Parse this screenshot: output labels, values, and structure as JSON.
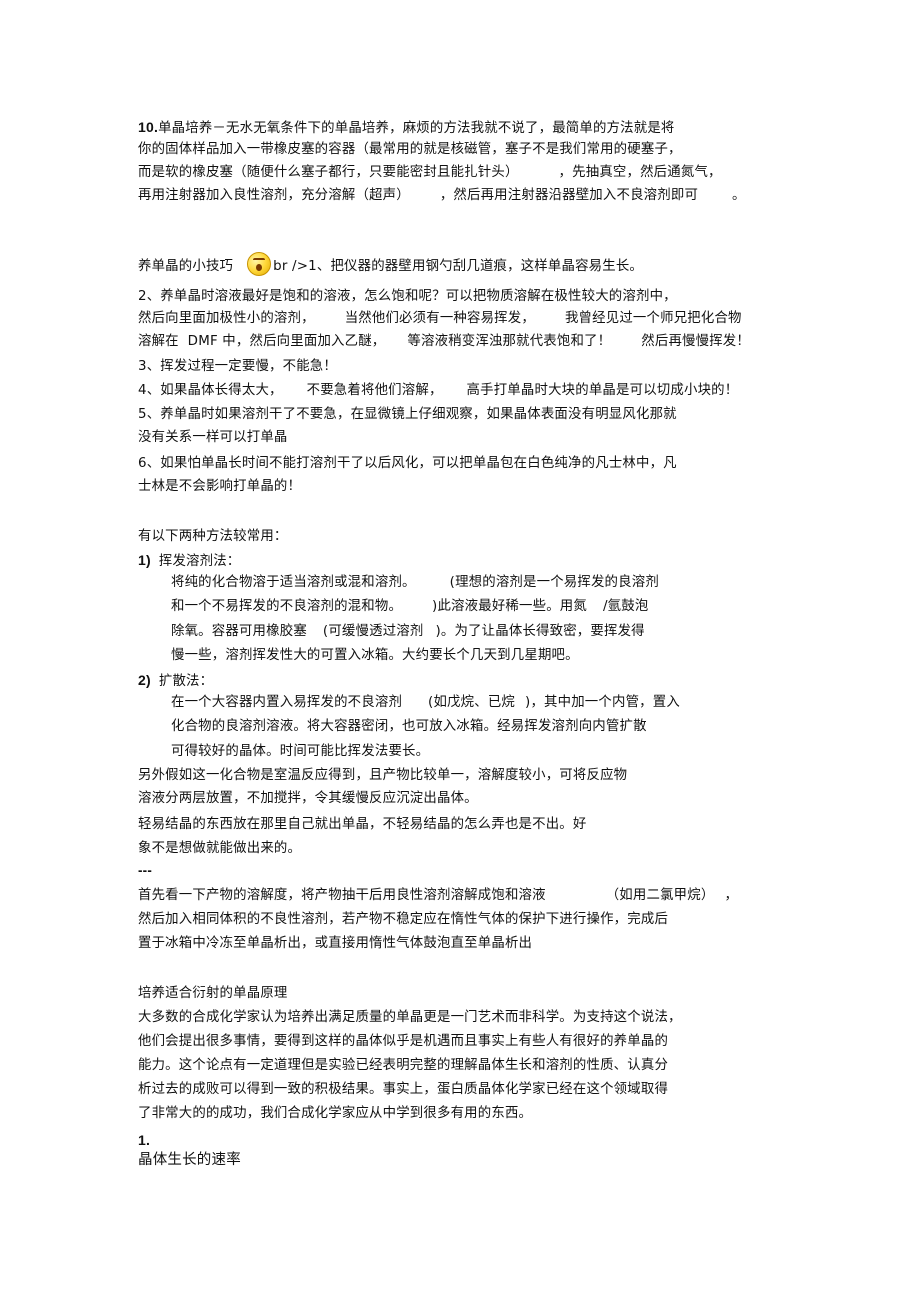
{
  "section1": {
    "num": "10.",
    "lines": [
      "单晶培养－无水无氧条件下的单晶培养，麻烦的方法我就不说了，最简单的方法就是将",
      "你的固体样品加入一带橡皮塞的容器（最常用的就是核磁管，塞子不是我们常用的硬塞子，",
      "而是软的橡皮塞（随便什么塞子都行，只要能密封且能扎针头）",
      "，先抽真空，然后通氮气，",
      "再用注射器加入良性溶剂，充分溶解（超声）",
      "，然后再用注射器沿器壁加入不良溶剂即可",
      "。"
    ]
  },
  "tips": {
    "title": "养单晶的小技巧",
    "emoji": "shocked-face-emoticon",
    "after_emoji": "br />1、把仪器的器壁用钢勺刮几道痕，这样单晶容易生长。",
    "item2": [
      "2、养单晶时溶液最好是饱和的溶液，怎么饱和呢？可以把物质溶解在极性较大的溶剂中，",
      "然后向里面加极性小的溶剂，",
      "当然他们必须有一种容易挥发，",
      "我曾经见过一个师兄把化合物",
      "溶解在  DMF 中，然后向里面加入乙醚，",
      "等溶液稍变浑浊那就代表饱和了！",
      "然后再慢慢挥发！"
    ],
    "item3": "3、挥发过程一定要慢，不能急！",
    "item4": [
      "4、如果晶体长得太大，",
      "不要急着将他们溶解，",
      "高手打单晶时大块的单晶是可以切成小块的！"
    ],
    "item5": [
      "5、养单晶时如果溶剂干了不要急，在显微镜上仔细观察，如果晶体表面没有明显风化那就",
      "没有关系一样可以打单晶"
    ],
    "item6": [
      "6、如果怕单晶长时间不能打溶剂干了以后风化，可以把单晶包在白色纯净的凡士林中，凡",
      "士林是不会影响打单晶的！"
    ]
  },
  "methods": {
    "intro": "有以下两种方法较常用：",
    "m1_num": "1)",
    "m1_title": "挥发溶剂法：",
    "m1_lines": [
      [
        "将纯的化合物溶于适当溶剂或混和溶剂。",
        "(理想的溶剂是一个易挥发的良溶剂"
      ],
      [
        "和一个不易挥发的不良溶剂的混和物。",
        ")此溶液最好稀一些。用氮",
        "/氩鼓泡"
      ],
      [
        "除氧。容器可用橡胶塞",
        "(可缓慢透过溶剂",
        ")。为了让晶体长得致密，要挥发得"
      ],
      [
        "慢一些，溶剂挥发性大的可置入冰箱。大约要长个几天到几星期吧。"
      ]
    ],
    "m2_num": "2)",
    "m2_title": "扩散法：",
    "m2_lines": [
      [
        "在一个大容器内置入易挥发的不良溶剂",
        "(如戊烷、已烷",
        ")，其中加一个内管，置入"
      ],
      [
        "化合物的良溶剂溶液。将大容器密闭，也可放入冰箱。经易挥发溶剂向内管扩散"
      ],
      [
        "可得较好的晶体。时间可能比挥发法要长。"
      ]
    ],
    "extra": [
      "另外假如这一化合物是室温反应得到，且产物比较单一，溶解度较小，可将反应物",
      "溶液分两层放置，不加搅拌，令其缓慢反应沉淀出晶体。",
      "轻易结晶的东西放在那里自己就出单晶，不轻易结晶的怎么弄也是不出。好",
      "象不是想做就能做出来的。"
    ]
  },
  "separator": "---",
  "section3": {
    "line1a": "首先看一下产物的溶解度，将产物抽干后用良性溶剂溶解成饱和溶液",
    "line1b": "（如用二氯甲烷）",
    "line1c": "，",
    "line2": "然后加入相同体积的不良性溶剂，若产物不稳定应在惰性气体的保护下进行操作，完成后",
    "line3": "置于冰箱中冷冻至单晶析出，或直接用惰性气体鼓泡直至单晶析出"
  },
  "section4": {
    "title": "培养适合衍射的单晶原理",
    "lines": [
      "大多数的合成化学家认为培养出满足质量的单晶更是一门艺术而非科学。为支持这个说法，",
      "他们会提出很多事情，要得到这样的晶体似乎是机遇而且事实上有些人有很好的养单晶的",
      "能力。这个论点有一定道理但是实验已经表明完整的理解晶体生长和溶剂的性质、认真分",
      "析过去的成败可以得到一致的积极结果。事实上，蛋白质晶体化学家已经在这个领域取得",
      "了非常大的的成功，我们合成化学家应从中学到很多有用的东西。"
    ],
    "sub_num": "1.",
    "sub_title": "晶体生长的速率"
  }
}
